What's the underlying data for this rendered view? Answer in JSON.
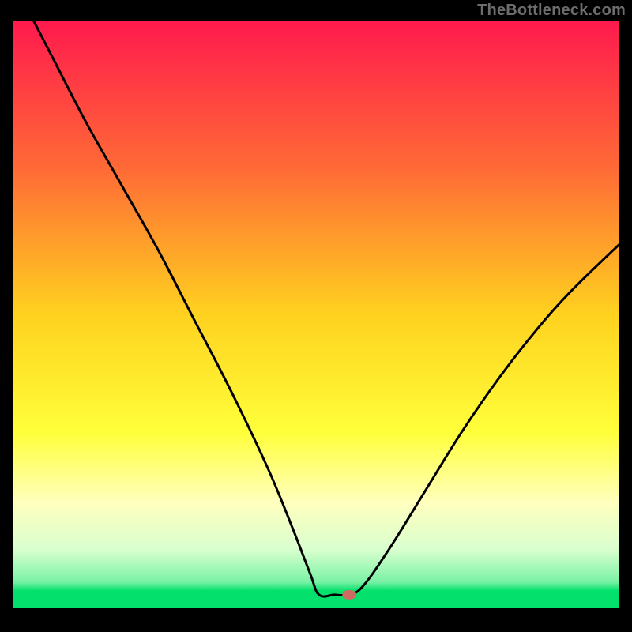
{
  "watermark": {
    "text": "TheBottleneck.com"
  },
  "chart_data": {
    "type": "line",
    "title": "",
    "xlabel": "",
    "ylabel": "",
    "xlim": [
      0,
      100
    ],
    "ylim": [
      0,
      100
    ],
    "gradient_stops": [
      {
        "offset": 0,
        "color": "#ff1a4d"
      },
      {
        "offset": 0.25,
        "color": "#ff6a36"
      },
      {
        "offset": 0.5,
        "color": "#ffd21f"
      },
      {
        "offset": 0.7,
        "color": "#ffff3a"
      },
      {
        "offset": 0.82,
        "color": "#ffffbe"
      },
      {
        "offset": 0.9,
        "color": "#d9ffcf"
      },
      {
        "offset": 0.955,
        "color": "#7af2a6"
      },
      {
        "offset": 0.97,
        "color": "#03e16c"
      },
      {
        "offset": 1.0,
        "color": "#03e16c"
      }
    ],
    "green_band_top_fraction": 0.97,
    "curve_points": [
      {
        "x": 3.5,
        "y": 100
      },
      {
        "x": 7,
        "y": 93
      },
      {
        "x": 12,
        "y": 83
      },
      {
        "x": 18,
        "y": 72
      },
      {
        "x": 24,
        "y": 61
      },
      {
        "x": 30,
        "y": 49
      },
      {
        "x": 36,
        "y": 37
      },
      {
        "x": 42,
        "y": 24
      },
      {
        "x": 46,
        "y": 14
      },
      {
        "x": 49,
        "y": 6
      },
      {
        "x": 50.5,
        "y": 2.3
      },
      {
        "x": 53,
        "y": 2.3
      },
      {
        "x": 55,
        "y": 2.3
      },
      {
        "x": 57.5,
        "y": 3.5
      },
      {
        "x": 62,
        "y": 10
      },
      {
        "x": 68,
        "y": 20
      },
      {
        "x": 74,
        "y": 30
      },
      {
        "x": 80,
        "y": 39
      },
      {
        "x": 86,
        "y": 47
      },
      {
        "x": 92,
        "y": 54
      },
      {
        "x": 100,
        "y": 62
      }
    ],
    "marker": {
      "x": 55.5,
      "y": 2.3,
      "rx": 9,
      "ry": 6
    },
    "colors": {
      "curve": "#000000",
      "frame": "#000000",
      "marker": "#cf6a63",
      "green": "#03e16c"
    }
  }
}
